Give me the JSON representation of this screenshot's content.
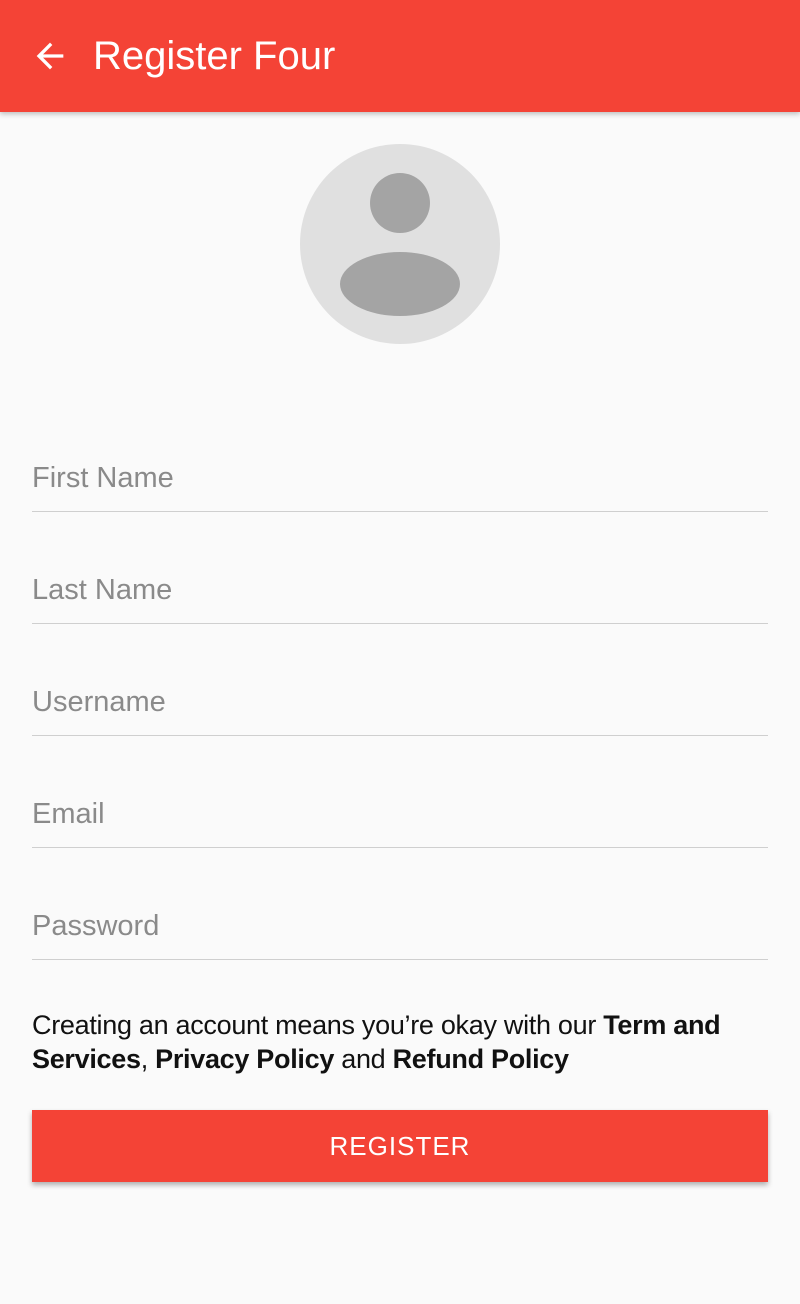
{
  "appbar": {
    "title": "Register Four",
    "back_icon": "arrow-back-icon",
    "color": "#f44336"
  },
  "avatar": {
    "icon": "person-icon"
  },
  "form": {
    "first_name": {
      "placeholder": "First Name",
      "value": ""
    },
    "last_name": {
      "placeholder": "Last Name",
      "value": ""
    },
    "username": {
      "placeholder": "Username",
      "value": ""
    },
    "email": {
      "placeholder": "Email",
      "value": ""
    },
    "password": {
      "placeholder": "Password",
      "value": ""
    }
  },
  "terms": {
    "prefix": "Creating an account means you’re okay with our ",
    "terms_link": "Term and Services",
    "comma": ", ",
    "privacy_link": "Privacy Policy",
    "and": " and ",
    "refund_link": "Refund Policy"
  },
  "register_button": {
    "label": "REGISTER"
  }
}
